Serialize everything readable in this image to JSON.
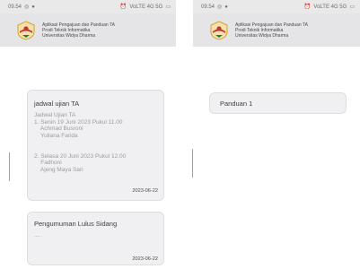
{
  "status": {
    "time": "09.54",
    "left_icons": [
      "whatsapp-icon",
      "circle-status-icon"
    ],
    "right_text": "VoLTE 4G 5G",
    "right_icons": [
      "alarm-icon",
      "wifi-icon",
      "signal-icon",
      "battery-icon"
    ]
  },
  "app": {
    "title_line1": "Aplikasi Pengajuan dan Panduan TA",
    "title_line2": "Prodi Teknik Informatika",
    "title_line3": "Universitas Widya Dharma"
  },
  "left_screen": {
    "cards": [
      {
        "title": "jadwal ujian TA",
        "body": "Jadwal Ujian TA\n1. Senin 19 Juni 2023 Pukul 11.00\n    Achmad Busroni\n    Yuliana Farida\n\n\n2. Selasa 20 Juni 2023 Pukul 12.00\n    Fadhoni\n    Ajeng Maya Sari",
        "date": "2023-06-22"
      },
      {
        "title": "Pengumuman Lulus Sidang",
        "body": "....",
        "date": "2023-06-22"
      }
    ]
  },
  "right_screen": {
    "items": [
      {
        "title": "Panduan 1"
      }
    ]
  },
  "colors": {
    "statusbar": "#e9e9ea",
    "header": "#e5e5e8",
    "card": "#f0f0f2",
    "text_dark": "#3d3d40",
    "text_muted": "#9b9ba2",
    "logo_red": "#c0392b",
    "logo_gold": "#d9a521"
  }
}
